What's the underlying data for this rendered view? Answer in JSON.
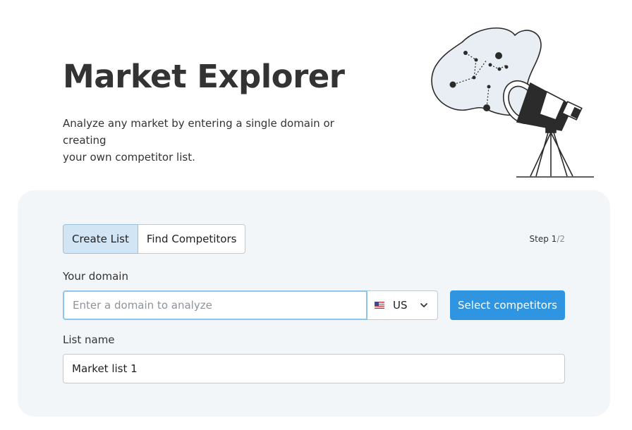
{
  "header": {
    "title": "Market Explorer",
    "subtitle_line1": "Analyze any market by entering a single domain or creating",
    "subtitle_line2": "your own competitor list."
  },
  "illustration": {
    "icon": "telescope-constellation-illustration"
  },
  "tabs": [
    {
      "label": "Create List",
      "active": true
    },
    {
      "label": "Find Competitors",
      "active": false
    }
  ],
  "step": {
    "label": "Step 1",
    "total": "/2"
  },
  "domain": {
    "label": "Your domain",
    "placeholder": "Enter a domain to analyze",
    "value": ""
  },
  "country": {
    "code": "US",
    "flag_icon": "us-flag-icon"
  },
  "select_button": {
    "label": "Select competitors"
  },
  "list_name": {
    "label": "List name",
    "value": "Market list 1"
  },
  "colors": {
    "accent": "#2f95e0",
    "active_tab": "#d2e5f5",
    "card_bg": "#f3f6f9"
  }
}
